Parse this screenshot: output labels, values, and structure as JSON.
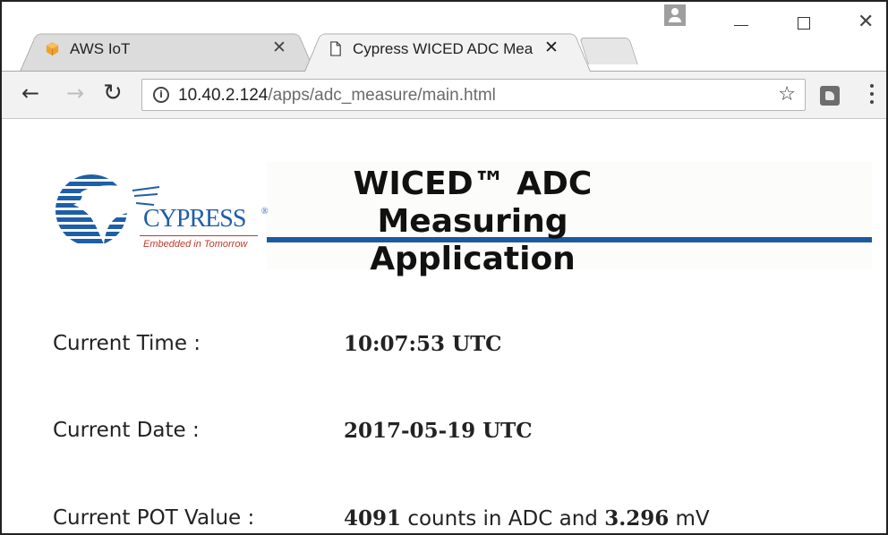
{
  "browser": {
    "tabs": [
      {
        "title": "AWS IoT",
        "favicon": "aws-cube-icon",
        "active": false
      },
      {
        "title": "Cypress WICED ADC Mea",
        "favicon": "document-icon",
        "active": true
      }
    ],
    "address": {
      "host": "10.40.2.124",
      "path": "/apps/adc_measure/main.html"
    }
  },
  "page": {
    "logo": {
      "brand": "CYPRESS",
      "tagline": "Embedded in Tomorrow"
    },
    "banner_title_lines": [
      "WICED™ ADC",
      "Measuring",
      "Application"
    ],
    "readings": {
      "time": {
        "label": "Current Time :",
        "value": "10:07:53 UTC"
      },
      "date": {
        "label": "Current Date :",
        "value": "2017-05-19 UTC"
      },
      "pot": {
        "label": "Current POT Value :",
        "counts": "4091",
        "counts_suffix": " counts in ADC and ",
        "mv": "3.296",
        "mv_suffix": " mV"
      }
    }
  },
  "colors": {
    "brand_blue": "#1f5ea8",
    "banner_line": "#1a5aa0",
    "tagline_red": "#c0392b"
  }
}
